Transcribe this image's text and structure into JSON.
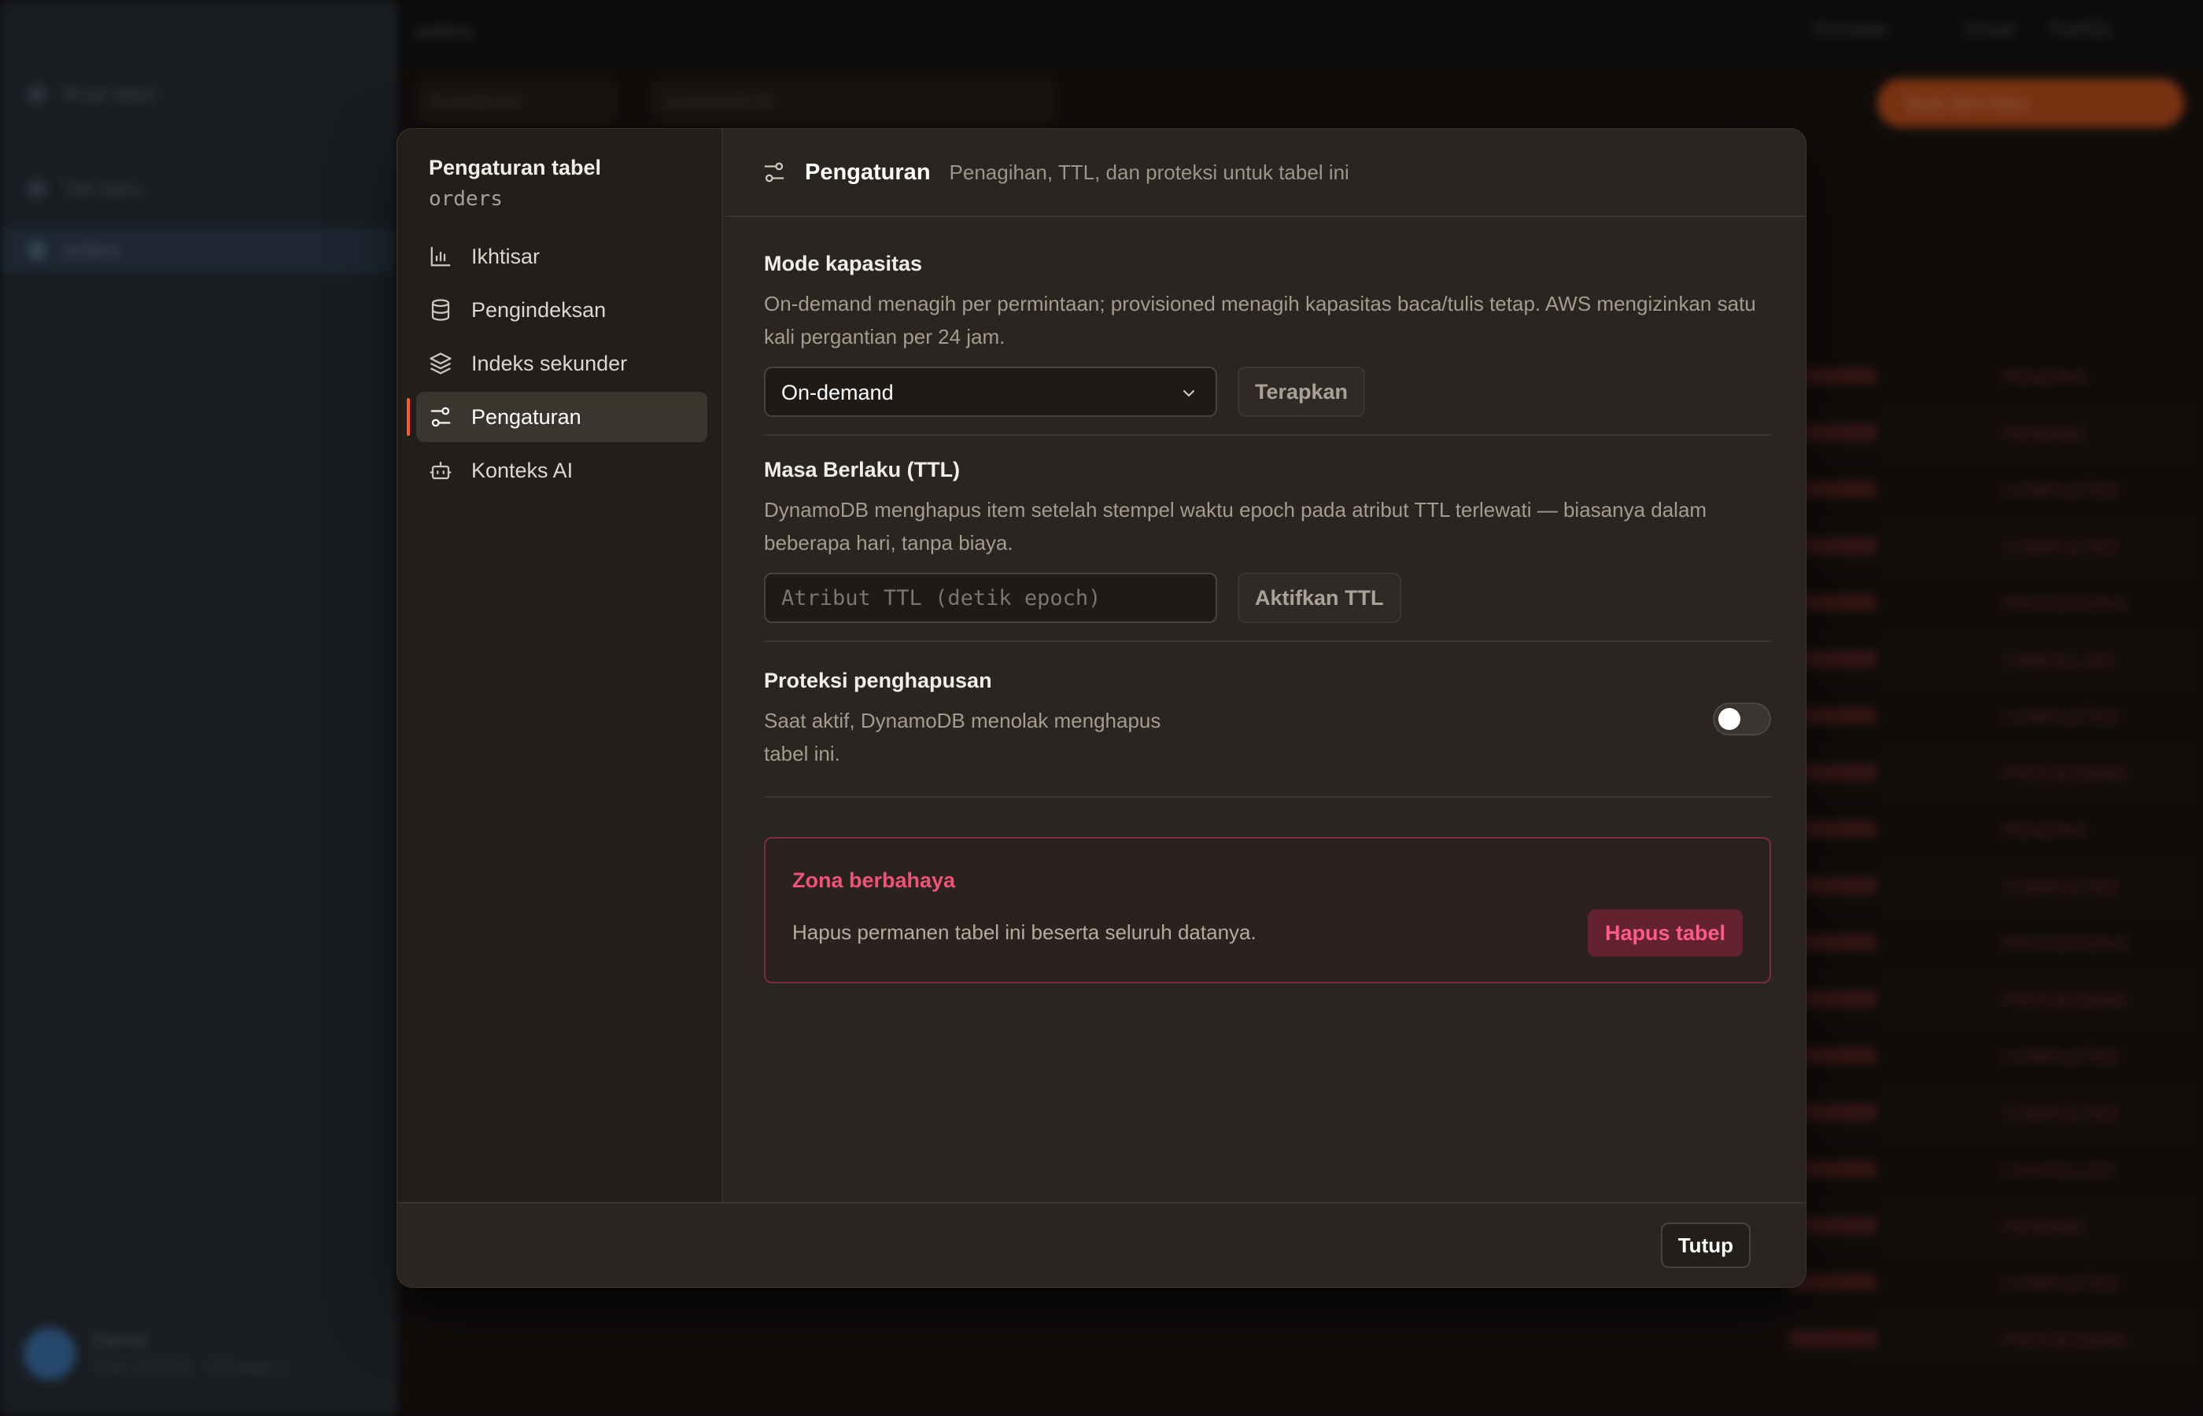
{
  "background": {
    "sidebar": {
      "items": [
        {
          "label": "Buat tabel",
          "icon": "plus-icon"
        },
        {
          "label": "Tab baru",
          "icon": "plus-icon"
        },
        {
          "label": "orders",
          "icon": "table-icon"
        }
      ],
      "user": {
        "name": "Demo",
        "subtitle": "Free (ID/EN) · 1/4 page 1"
      }
    },
    "topbar": {
      "title": "orders",
      "right": [
        "Simulate",
        "Visual",
        "PartiQL"
      ]
    },
    "toolbar": {
      "pills": [
        "Scan/Query",
        "customerId ID",
        "orderId"
      ],
      "primary": "Buat item baru"
    },
    "table_status": [
      "PENDING",
      "PENDING",
      "COMPLETED",
      "COMPLETED",
      "PROCESSING",
      "CANCELLED",
      "COMPLETED",
      "PROCESSING",
      "PENDING",
      "COMPLETED",
      "PROCESSING",
      "PROCESSING",
      "COMPLETED",
      "COMPLETED",
      "CANCELLED",
      "PENDING",
      "COMPLETED",
      "PROCESSING"
    ]
  },
  "modal": {
    "sidebar": {
      "title": "Pengaturan tabel",
      "table_name": "orders",
      "nav": [
        {
          "label": "Ikhtisar",
          "icon": "bar-chart-icon",
          "active": false
        },
        {
          "label": "Pengindeksan",
          "icon": "database-icon",
          "active": false
        },
        {
          "label": "Indeks sekunder",
          "icon": "layers-icon",
          "active": false
        },
        {
          "label": "Pengaturan",
          "icon": "sliders-icon",
          "active": true
        },
        {
          "label": "Konteks AI",
          "icon": "bot-icon",
          "active": false
        }
      ]
    },
    "header": {
      "title": "Pengaturan",
      "subtitle": "Penagihan, TTL, dan proteksi untuk tabel ini",
      "icon": "sliders-icon"
    },
    "capacity": {
      "title": "Mode kapasitas",
      "description": "On-demand menagih per permintaan; provisioned menagih kapasitas baca/tulis tetap. AWS mengizinkan satu kali pergantian per 24 jam.",
      "selected": "On-demand",
      "apply_label": "Terapkan"
    },
    "ttl": {
      "title": "Masa Berlaku (TTL)",
      "description": "DynamoDB menghapus item setelah stempel waktu epoch pada atribut TTL terlewati — biasanya dalam beberapa hari, tanpa biaya.",
      "placeholder": "Atribut TTL (detik epoch)",
      "value": "",
      "enable_label": "Aktifkan TTL"
    },
    "protection": {
      "title": "Proteksi penghapusan",
      "description": "Saat aktif, DynamoDB menolak menghapus tabel ini.",
      "enabled": false
    },
    "danger": {
      "title": "Zona berbahaya",
      "description": "Hapus permanen tabel ini beserta seluruh datanya.",
      "button_label": "Hapus tabel"
    },
    "footer": {
      "close_label": "Tutup"
    }
  },
  "colors": {
    "accent": "#ff5a1f",
    "danger": "#f0527a",
    "modal_bg": "#2a2520"
  }
}
